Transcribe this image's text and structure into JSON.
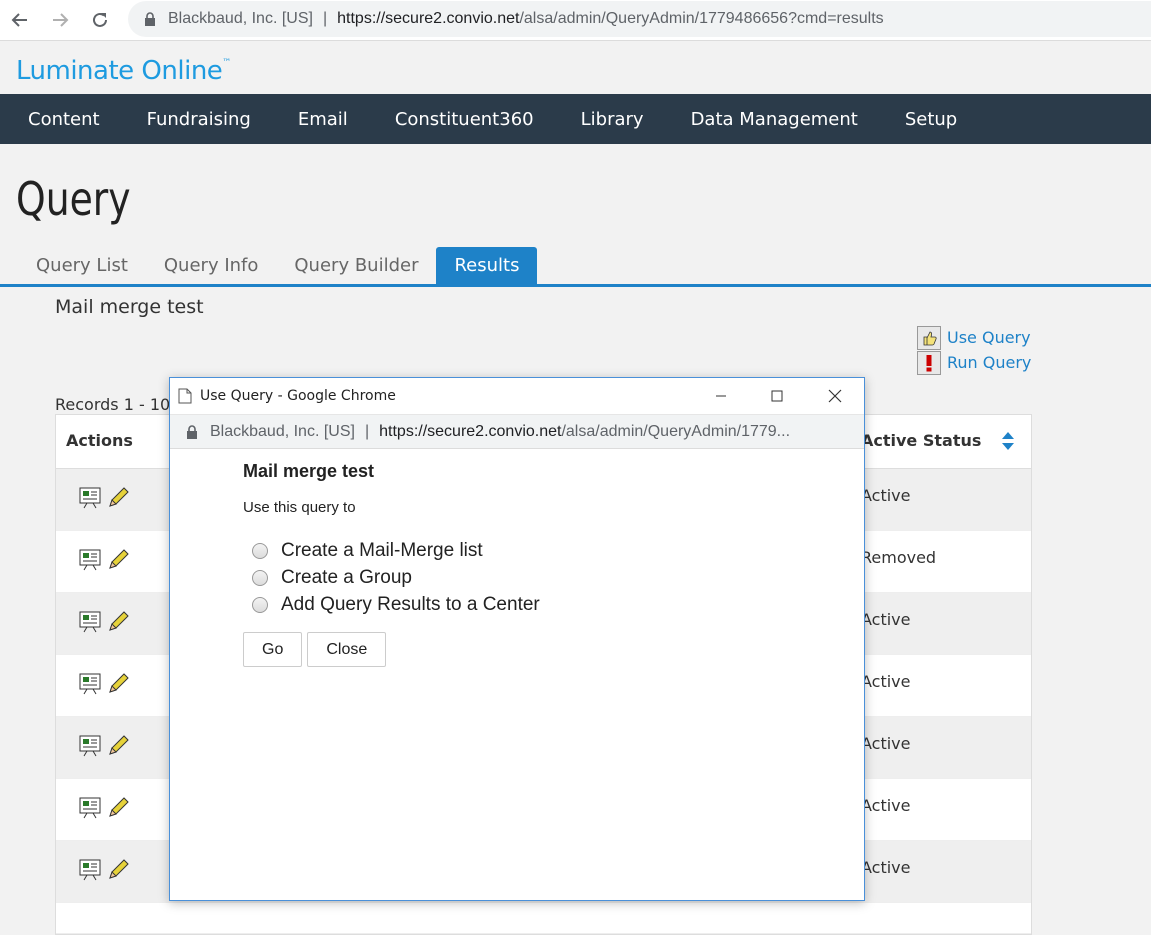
{
  "browser": {
    "org": "Blackbaud, Inc. [US]",
    "separator": "|",
    "url_host": "https://secure2.convio.net",
    "url_path": "/alsa/admin/QueryAdmin/1779486656?cmd=results"
  },
  "app": {
    "logo_text": "Luminate Online",
    "logo_tm": "™",
    "nav": [
      "Content",
      "Fundraising",
      "Email",
      "Constituent360",
      "Library",
      "Data Management",
      "Setup"
    ],
    "page_title": "Query",
    "tabs": [
      "Query List",
      "Query Info",
      "Query Builder",
      "Results"
    ],
    "active_tab": "Results",
    "query_name": "Mail merge test",
    "side_actions": {
      "use_query": "Use Query",
      "run_query": "Run Query"
    },
    "records_label": "Records 1 - 10",
    "table": {
      "col_actions": "Actions",
      "col_status": "Active Status",
      "rows": [
        "Active",
        "Removed",
        "Active",
        "Active",
        "Active",
        "Active",
        "Active"
      ]
    }
  },
  "popup": {
    "window_title": "Use Query - Google Chrome",
    "org": "Blackbaud, Inc. [US]",
    "separator": "|",
    "url_host": "https://secure2.convio.net",
    "url_path": "/alsa/admin/QueryAdmin/1779...",
    "heading": "Mail merge test",
    "subheading": "Use this query to",
    "options": [
      "Create a Mail-Merge list",
      "Create a Group",
      "Add Query Results to a Center"
    ],
    "go_label": "Go",
    "close_label": "Close"
  },
  "colors": {
    "nav_bg": "#2b3b4a",
    "accent": "#1e82c8",
    "logo": "#1e9be0"
  }
}
